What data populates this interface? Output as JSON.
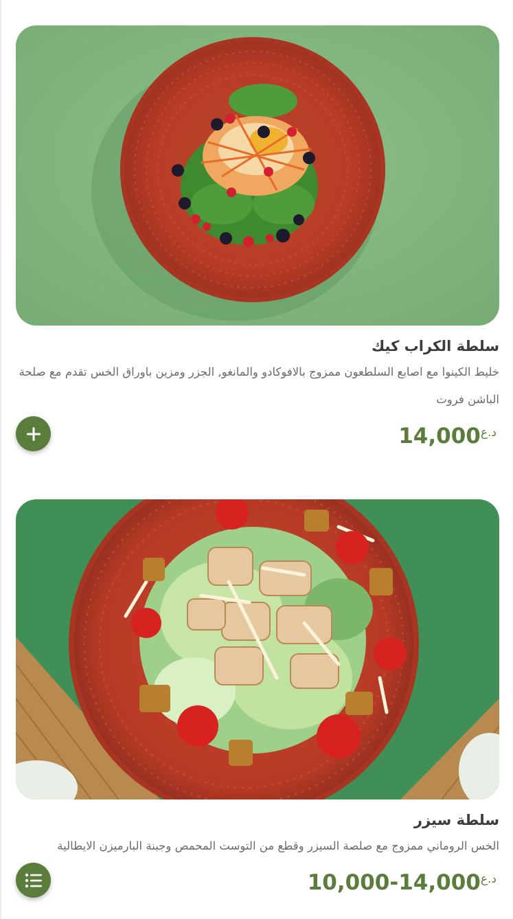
{
  "items": [
    {
      "name": "سلطة الكراب كيك",
      "description": "خليط الكينوا مع اصابع السلطعون ممزوج بالافوكادو والمانغو, الجزر ومزين باوراق الخس تقدم مع صلحة الباشن فروت",
      "price": "14,000",
      "currency": "د.ع",
      "action_icon": "plus-icon"
    },
    {
      "name": "سلطة سيزر",
      "description": "الخس الروماني ممزوج مع صلصة السيزر وقطع من التوست المحمص وجبنة البارميزن الايطالية",
      "price": "14,000-10,000",
      "currency": "د.ع",
      "action_icon": "list-icon"
    }
  ],
  "colors": {
    "accent": "#5b7d3b",
    "title": "#3c3c3c",
    "description": "#6b6b6b"
  }
}
